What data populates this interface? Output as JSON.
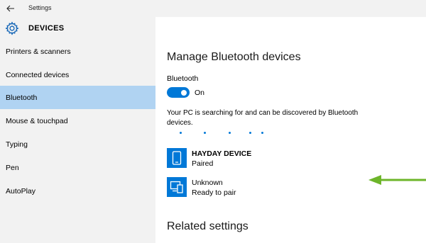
{
  "window": {
    "title": "Settings"
  },
  "header": {
    "title": "DEVICES"
  },
  "sidebar": {
    "items": [
      {
        "label": "Printers & scanners"
      },
      {
        "label": "Connected devices"
      },
      {
        "label": "Bluetooth"
      },
      {
        "label": "Mouse & touchpad"
      },
      {
        "label": "Typing"
      },
      {
        "label": "Pen"
      },
      {
        "label": "AutoPlay"
      }
    ],
    "selected": "Bluetooth"
  },
  "main": {
    "heading": "Manage Bluetooth devices",
    "bluetooth_label": "Bluetooth",
    "toggle_state": "On",
    "searching_text": "Your PC is searching for and can be discovered by Bluetooth devices.",
    "devices": [
      {
        "name": "HAYDAY DEVICE",
        "status": "Paired",
        "icon": "phone-icon"
      },
      {
        "name": "Unknown",
        "status": "Ready to pair",
        "icon": "devices-icon"
      }
    ],
    "related_heading": "Related settings"
  },
  "colors": {
    "accent": "#0078d7",
    "selected_nav": "#b0d3f2",
    "sidebar_bg": "#f2f2f2",
    "arrow": "#6db52a"
  }
}
